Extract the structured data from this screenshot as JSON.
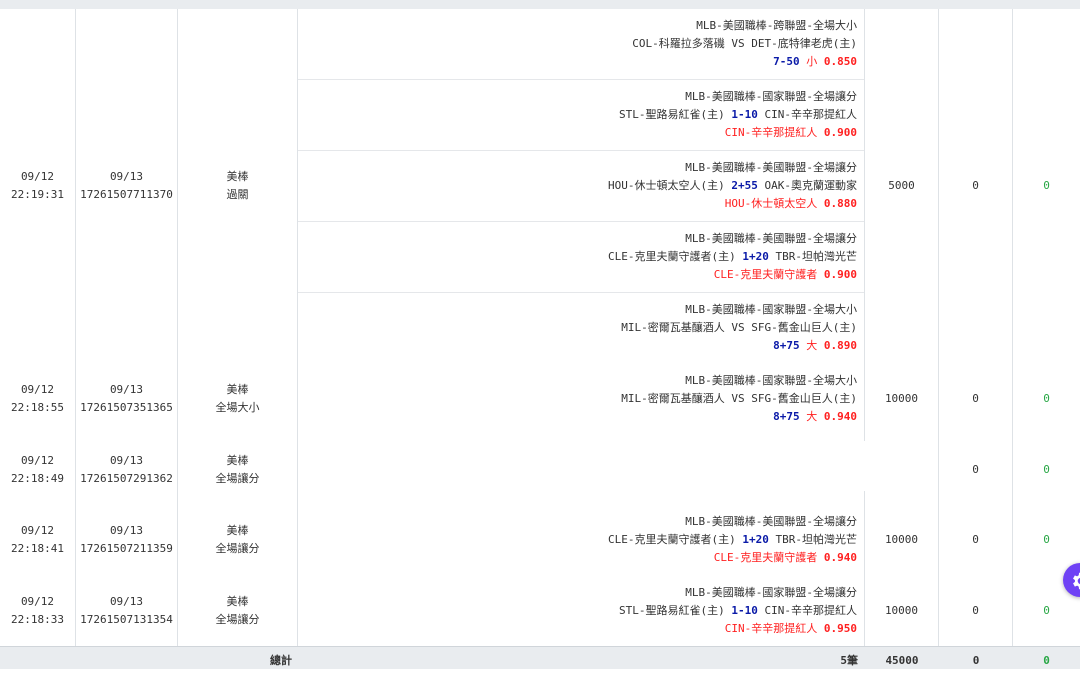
{
  "records": [
    {
      "date": "09/12",
      "time": "22:19:31",
      "settle_date": "09/13",
      "order_id": "17261507711370",
      "sport": "美棒",
      "bet_type": "過關",
      "bets": [
        {
          "league": "MLB-美國職棒-跨聯盟-全場大小",
          "home_mark": "",
          "team_a": "COL-科羅拉多落磯",
          "handicap": "VS",
          "team_b": "DET-底特律老虎(主)",
          "pick_hc": "7-50",
          "pick": "小",
          "odds": "0.850"
        },
        {
          "league": "MLB-美國職棒-國家聯盟-全場讓分",
          "team_a": "STL-聖路易紅雀(主)",
          "handicap": "1-10",
          "team_b": "CIN-辛辛那提紅人",
          "pick_hc": "",
          "pick": "CIN-辛辛那提紅人",
          "odds": "0.900"
        },
        {
          "league": "MLB-美國職棒-美國聯盟-全場讓分",
          "team_a": "HOU-休士頓太空人(主)",
          "handicap": "2+55",
          "team_b": "OAK-奧克蘭運動家",
          "pick_hc": "",
          "pick": "HOU-休士頓太空人",
          "odds": "0.880"
        },
        {
          "league": "MLB-美國職棒-美國聯盟-全場讓分",
          "team_a": "CLE-克里夫蘭守護者(主)",
          "handicap": "1+20",
          "team_b": "TBR-坦帕灣光芒",
          "pick_hc": "",
          "pick": "CLE-克里夫蘭守護者",
          "odds": "0.900"
        },
        {
          "league": "MLB-美國職棒-國家聯盟-全場大小",
          "team_a": "MIL-密爾瓦基釀酒人",
          "handicap": "VS",
          "team_b": "SFG-舊金山巨人(主)",
          "pick_hc": "8+75",
          "pick": "大",
          "odds": "0.890"
        }
      ],
      "amount": "5000",
      "win": "0",
      "result": "0"
    },
    {
      "date": "09/12",
      "time": "22:18:55",
      "settle_date": "09/13",
      "order_id": "17261507351365",
      "sport": "美棒",
      "bet_type": "全場大小",
      "bets": [
        {
          "league": "MLB-美國職棒-國家聯盟-全場大小",
          "team_a": "MIL-密爾瓦基釀酒人",
          "handicap": "VS",
          "team_b": "SFG-舊金山巨人(主)",
          "pick_hc": "8+75",
          "pick": "大",
          "odds": "0.940"
        }
      ],
      "amount": "10000",
      "win": "0",
      "result": "0"
    },
    {
      "date": "09/12",
      "time": "22:18:49",
      "settle_date": "09/13",
      "order_id": "17261507291362",
      "sport": "美棒",
      "bet_type": "全場讓分",
      "bets": [],
      "amount": "",
      "win": "0",
      "result": "0"
    },
    {
      "date": "09/12",
      "time": "22:18:41",
      "settle_date": "09/13",
      "order_id": "17261507211359",
      "sport": "美棒",
      "bet_type": "全場讓分",
      "bets": [
        {
          "league": "MLB-美國職棒-美國聯盟-全場讓分",
          "team_a": "CLE-克里夫蘭守護者(主)",
          "handicap": "1+20",
          "team_b": "TBR-坦帕灣光芒",
          "pick_hc": "",
          "pick": "CLE-克里夫蘭守護者",
          "odds": "0.940"
        }
      ],
      "amount": "10000",
      "win": "0",
      "result": "0"
    },
    {
      "date": "09/12",
      "time": "22:18:33",
      "settle_date": "09/13",
      "order_id": "17261507131354",
      "sport": "美棒",
      "bet_type": "全場讓分",
      "bets": [
        {
          "league": "MLB-美國職棒-國家聯盟-全場讓分",
          "team_a": "STL-聖路易紅雀(主)",
          "handicap": "1-10",
          "team_b": "CIN-辛辛那提紅人",
          "pick_hc": "",
          "pick": "CIN-辛辛那提紅人",
          "odds": "0.950"
        }
      ],
      "amount": "10000",
      "win": "0",
      "result": "0"
    }
  ],
  "totals": {
    "label": "總計",
    "count": "5筆",
    "amount": "45000",
    "win": "0",
    "result": "0"
  },
  "colors": {
    "handicap": "#0a1aa8",
    "pick": "#ff2020",
    "result": "#28a745",
    "floating_button": "#6f42f5"
  },
  "icons": {
    "floating_button": "gear-icon"
  }
}
